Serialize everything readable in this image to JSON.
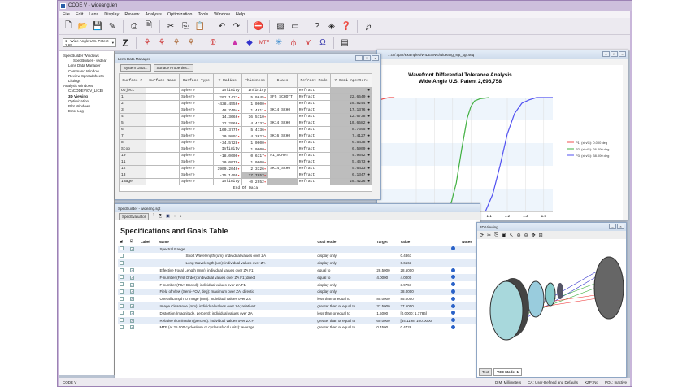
{
  "app": {
    "title": "CODE V - wideang.len",
    "menu": [
      "File",
      "Edit",
      "Lens",
      "Display",
      "Review",
      "Analysis",
      "Optimization",
      "Tools",
      "Window",
      "Help"
    ],
    "config_select": "1 - Wide Angle  U.S. Patent 2,69",
    "zoom_label": "Z",
    "status_left": "CODE V",
    "status_right": [
      "DIM: Millimeters",
      "CA: User-Defined and Defaults",
      "XZP: No",
      "POL: Inactive"
    ]
  },
  "toolbar1": [
    "new-file-icon",
    "open-folder-icon",
    "save-icon",
    "edit-icon",
    "print-icon",
    "print-preview-icon",
    "cut-icon",
    "copy-icon",
    "paste-icon",
    "undo-icon",
    "redo-icon",
    "stop-icon",
    "view-icon",
    "disabled-icon",
    "help-icon",
    "layers-icon",
    "whats-this-icon",
    "macro-icon"
  ],
  "tree": [
    "SpecBuilder Windows",
    "SpecBuilder - widear",
    "Lens Data Manager",
    "Command Window",
    "Review Spreadsheets",
    "Listings",
    "Analysis Windows",
    "C:\\CODEV\\CV_LICE\\",
    "3D Viewing",
    "Optimization",
    "Plot Windows",
    "Error Log"
  ],
  "ldm": {
    "title": "Lens Data Manager",
    "tabs": [
      "System Data...",
      "Surface Properties..."
    ],
    "headers": [
      "Surface #",
      "Surface Name",
      "Surface Type",
      "Y Radius",
      "Thickness",
      "Glass",
      "Refract Mode",
      "Y Semi-Aperture"
    ],
    "rows": [
      [
        "Object",
        "",
        "Sphere",
        "Infinity",
        "Infinity",
        "",
        "Refract",
        ""
      ],
      [
        "1",
        "",
        "Sphere",
        "202.1421",
        "5.9645",
        "SF5_SCHOTT",
        "Refract",
        "22.6540"
      ],
      [
        "2",
        "",
        "Sphere",
        "-438.4556",
        "1.0000",
        "",
        "Refract",
        "20.8244"
      ],
      [
        "3",
        "",
        "Sphere",
        "48.7404",
        "1.4811",
        "SK14_SCHO",
        "Refract",
        "17.1376"
      ],
      [
        "4",
        "",
        "Sphere",
        "14.3666",
        "16.5710",
        "",
        "Refract",
        "12.6738"
      ],
      [
        "5",
        "",
        "Sphere",
        "32.2966",
        "4.4732",
        "SK14_SCHO",
        "Refract",
        "10.6582"
      ],
      [
        "6",
        "",
        "Sphere",
        "160.3775",
        "5.4736",
        "",
        "Refract",
        "8.7395"
      ],
      [
        "7",
        "",
        "Sphere",
        "20.9897",
        "4.3623",
        "SK16_SCHO",
        "Refract",
        "7.4127"
      ],
      [
        "8",
        "",
        "Sphere",
        "-34.5728",
        "1.0000",
        "",
        "Refract",
        "6.5438"
      ],
      [
        "Stop",
        "",
        "Sphere",
        "Infinity",
        "1.0000",
        "",
        "Refract",
        "6.5909"
      ],
      [
        "10",
        "",
        "Sphere",
        "-18.0600",
        "0.6317",
        "F1_SCHOTT",
        "Refract",
        "4.9542"
      ],
      [
        "11",
        "",
        "Sphere",
        "20.0079",
        "1.0000",
        "",
        "Refract",
        "5.4573"
      ],
      [
        "12",
        "",
        "Sphere",
        "3909.2040",
        "2.3326",
        "SK14_SCHO",
        "Refract",
        "5.6423"
      ],
      [
        "13",
        "",
        "Sphere",
        "-15.1499",
        "37.7852",
        "",
        "Refract",
        "6.1347"
      ],
      [
        "Image",
        "",
        "Sphere",
        "Infinity",
        "-0.2952",
        "",
        "Refract",
        "20.4226"
      ]
    ],
    "end": "End Of Data"
  },
  "plotwin": {
    "title": "...cv/.cpar/examples/WIDEANG/wideang_sgt_sgt.seq"
  },
  "chart_data": {
    "type": "line",
    "title": "Wavefront Differential Tolerance Analysis",
    "subtitle": "Wide Angle   U.S. Patent 2,696,758",
    "xticks": [
      "1.1",
      "1.2",
      "1.3",
      "1.4"
    ],
    "xlim": [
      0.45,
      1.45
    ],
    "ylim": [
      0,
      1
    ],
    "grid": true,
    "legend": "right",
    "series": [
      {
        "name": "P1: (xin/G): 0.000 deg",
        "color": "#f05050",
        "x": [
          0.45,
          0.48,
          0.5,
          0.52,
          0.55,
          0.58
        ],
        "y": [
          0.9,
          0.96,
          0.98,
          0.99,
          1.0,
          1.0
        ]
      },
      {
        "name": "P2: (xin/G): 26.200 deg",
        "color": "#40b040",
        "x": [
          0.88,
          0.92,
          0.95,
          0.98,
          1.0,
          1.02,
          1.05,
          1.1
        ],
        "y": [
          0.0,
          0.25,
          0.55,
          0.82,
          0.92,
          0.97,
          0.99,
          1.0
        ]
      },
      {
        "name": "P3: (xin/G): 38.000 deg",
        "color": "#5050f0",
        "x": [
          1.08,
          1.12,
          1.16,
          1.2,
          1.24,
          1.28,
          1.32,
          1.36,
          1.45
        ],
        "y": [
          0.0,
          0.15,
          0.4,
          0.68,
          0.86,
          0.95,
          0.98,
          1.0,
          1.0
        ]
      }
    ]
  },
  "spec": {
    "title": "SpecBuilder - wideang.sgt",
    "evaluate": "SpecEvaluator",
    "heading": "Specifications and Goals Table",
    "headers": [
      "Label",
      "Name",
      "Goal Mode",
      "Target",
      "Value",
      "Notes"
    ],
    "rows": [
      {
        "cb": true,
        "name": "Spectral Range",
        "indent": 0,
        "mode": "",
        "target": "",
        "value": "",
        "info": true
      },
      {
        "cb": false,
        "name": "Short Wavelength (um): individual values over ZA",
        "indent": 2,
        "mode": "display only",
        "target": "",
        "value": "0.4861",
        "info": false
      },
      {
        "cb": false,
        "name": "Long Wavelength (um): individual values over ZA",
        "indent": 2,
        "mode": "display only",
        "target": "",
        "value": "0.6563",
        "info": false
      },
      {
        "cb": true,
        "name": "Effective Focal Length (mm): individual values over ZA F1;",
        "indent": 0,
        "mode": "equal to",
        "target": "28.5000",
        "value": "28.5000",
        "info": true
      },
      {
        "cb": true,
        "name": "F-number (First Order): individual values over ZA F1; direct",
        "indent": 0,
        "mode": "equal to",
        "target": "4.0000",
        "value": "4.0000",
        "info": true
      },
      {
        "cb": true,
        "name": "F-number (FSA-Based): individual values over ZA F1",
        "indent": 0,
        "mode": "display only",
        "target": "",
        "value": "3.9757",
        "info": true
      },
      {
        "cb": true,
        "name": "Field of View (Semi-FOV, deg): maximum over ZA; directio",
        "indent": 0,
        "mode": "display only",
        "target": "",
        "value": "38.0000",
        "info": true
      },
      {
        "cb": true,
        "name": "Overall Length to Image (mm): individual values over ZA",
        "indent": 0,
        "mode": "less than or equal to",
        "target": "85.0000",
        "value": "85.0000",
        "info": true
      },
      {
        "cb": true,
        "name": "Image Clearance (mm): individual values over ZA; relative t",
        "indent": 0,
        "mode": "greater than or equal to",
        "target": "37.5000",
        "value": "37.5000",
        "info": true
      },
      {
        "cb": true,
        "name": "Distortion (magnitude, percent): individual values over ZA",
        "indent": 0,
        "mode": "less than or equal to",
        "target": "1.5000",
        "value": "[0.0000; 1.1786]",
        "info": true
      },
      {
        "cb": true,
        "name": "Relative Illumination (percent): individual values over ZA F",
        "indent": 0,
        "mode": "greater than or equal to",
        "target": "60.0000",
        "value": "[64.1198; 100.0000]",
        "info": true
      },
      {
        "cb": true,
        "name": "MTF (at 25.000 cycles/mm or cycles/afocal units): average",
        "indent": 0,
        "mode": "greater than or equal to",
        "target": "0.4500",
        "value": "0.4728",
        "info": true
      }
    ]
  },
  "viewer": {
    "title": "3D Viewing",
    "tabs": [
      "Text",
      "V3D Model 1"
    ]
  }
}
